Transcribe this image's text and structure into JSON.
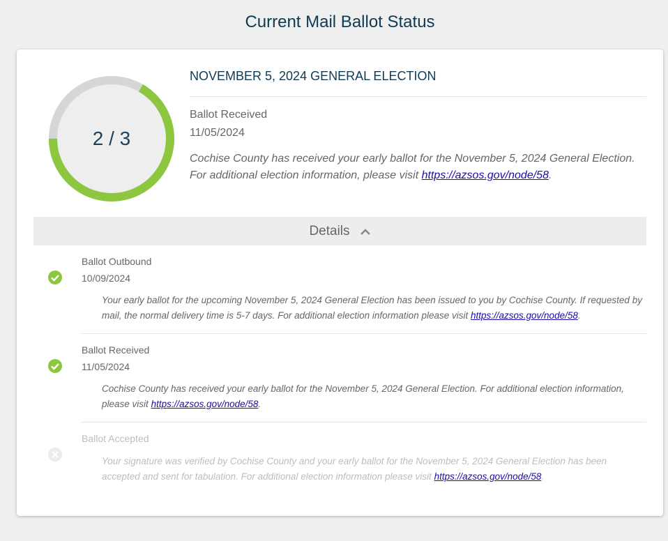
{
  "page": {
    "title": "Current Mail Ballot Status"
  },
  "summary": {
    "progress_label": "2 / 3",
    "progress_completed": 2,
    "progress_total": 3,
    "election_name": "NOVEMBER 5, 2024 GENERAL ELECTION",
    "status": "Ballot Received",
    "date": "11/05/2024",
    "description": "Cochise County has received your early ballot for the November 5, 2024 General Election. For additional election information, please visit",
    "link_text": "https://azsos.gov/node/58",
    "trailing": "."
  },
  "details": {
    "label": "Details",
    "icon": "chevron-up-icon"
  },
  "steps": [
    {
      "title": "Ballot Outbound",
      "date": "10/09/2024",
      "description": "Your early ballot for the upcoming November 5, 2024 General Election has been issued to you by Cochise County. If requested by mail, the normal delivery time is 5-7 days. For additional election information please visit",
      "link_text": "https://azsos.gov/node/58",
      "trailing": ".",
      "icon": "check-circle-icon",
      "complete": true
    },
    {
      "title": "Ballot Received",
      "date": "11/05/2024",
      "description": "Cochise County has received your early ballot for the November 5, 2024 General Election. For additional election information, please visit",
      "link_text": "https://azsos.gov/node/58",
      "trailing": ".",
      "icon": "check-circle-icon",
      "complete": true
    },
    {
      "title": "Ballot Accepted",
      "date": "",
      "description": "Your signature was verified by Cochise County and your early ballot for the November 5, 2024 General Election has been accepted and sent for tabulation. For additional election information please visit",
      "link_text": "https://azsos.gov/node/58",
      "trailing": ".",
      "icon": "x-circle-icon",
      "complete": false
    }
  ],
  "colors": {
    "accent": "#8dc63f",
    "ring_track": "#d6d6d6",
    "title": "#0f3a54",
    "link": "#1a0dab"
  }
}
